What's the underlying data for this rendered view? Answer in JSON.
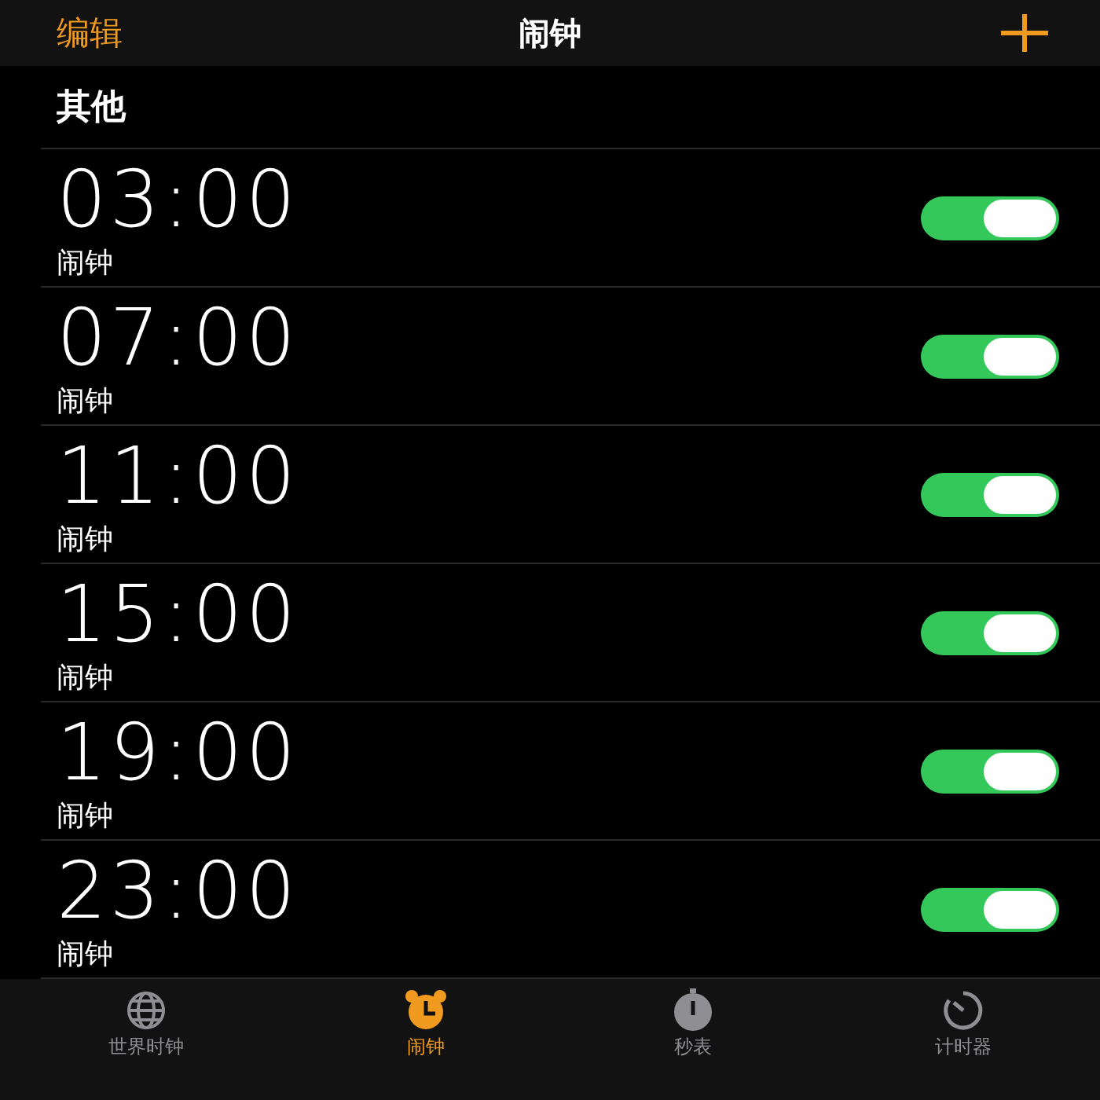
{
  "nav": {
    "edit": "编辑",
    "title": "闹钟"
  },
  "section": "其他",
  "alarms": [
    {
      "time": "03:00",
      "label": "闹钟",
      "on": true
    },
    {
      "time": "07:00",
      "label": "闹钟",
      "on": true
    },
    {
      "time": "11:00",
      "label": "闹钟",
      "on": true
    },
    {
      "time": "15:00",
      "label": "闹钟",
      "on": true
    },
    {
      "time": "19:00",
      "label": "闹钟",
      "on": true
    },
    {
      "time": "23:00",
      "label": "闹钟",
      "on": true
    }
  ],
  "tabs": [
    {
      "kind": "globe",
      "label": "世界时钟",
      "selected": false
    },
    {
      "kind": "alarm",
      "label": "闹钟",
      "selected": true
    },
    {
      "kind": "stopwatch",
      "label": "秒表",
      "selected": false
    },
    {
      "kind": "timer",
      "label": "计时器",
      "selected": false
    }
  ]
}
